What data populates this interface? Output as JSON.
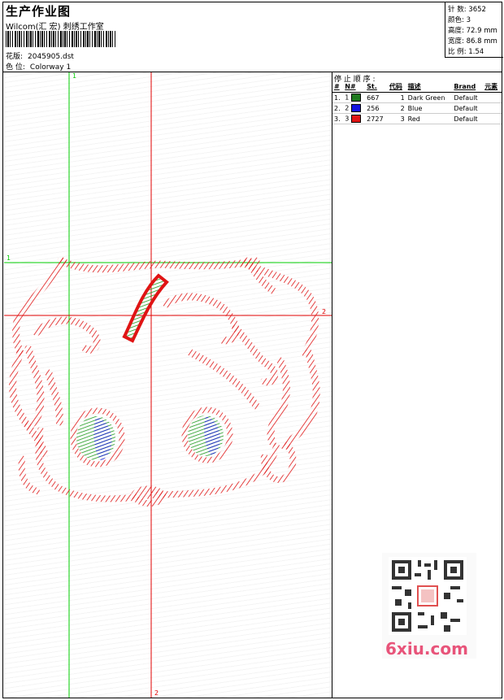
{
  "header": {
    "title": "生产作业图",
    "company": "Wilcom(汇 宏) 刺绣工作室",
    "design_label": "花版:",
    "design_value": "2045905.dst",
    "colorway_label": "色 位:",
    "colorway_value": "Colorway 1"
  },
  "stats": [
    {
      "label": "针 数:",
      "value": "3652"
    },
    {
      "label": "颜色:",
      "value": "3"
    },
    {
      "label": "高度:",
      "value": "72.9 mm"
    },
    {
      "label": "宽度:",
      "value": "86.8 mm"
    },
    {
      "label": "比 例:",
      "value": "1.54"
    }
  ],
  "stop_sequence": {
    "title": "停 止 顺 序 :",
    "columns": [
      "#",
      "N#",
      "St.",
      "代码",
      "描述",
      "Brand",
      "元素"
    ],
    "rows": [
      {
        "num": "1.",
        "n": "1",
        "color": "#1e7a1e",
        "stitches": "667",
        "code": "1",
        "desc": "Dark Green",
        "brand": "Default"
      },
      {
        "num": "2.",
        "n": "2",
        "color": "#1414e0",
        "stitches": "256",
        "code": "2",
        "desc": "Blue",
        "brand": "Default"
      },
      {
        "num": "3.",
        "n": "3",
        "color": "#e01414",
        "stitches": "2727",
        "code": "3",
        "desc": "Red",
        "brand": "Default"
      }
    ]
  },
  "guides": {
    "v_label_top": "1",
    "h_label_left": "1",
    "h_label_right": "2",
    "v_label_bottom": "2"
  },
  "watermark": {
    "text": "6xiu.com"
  },
  "colors": {
    "green_guide": "#00cc00",
    "red_guide": "#e00000",
    "stitch_red": "#e01414",
    "stitch_green": "#1e9a1e",
    "stitch_blue": "#1414e0"
  }
}
